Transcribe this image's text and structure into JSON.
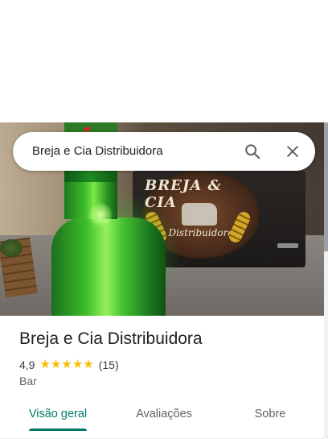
{
  "search": {
    "query": "Breja e Cia Distribuidora",
    "search_icon": "search-icon",
    "close_icon": "close-icon"
  },
  "hero": {
    "sign_line1": "BREJA & CIA",
    "sign_line2": "Distribuidora"
  },
  "place": {
    "name": "Breja e Cia Distribuidora",
    "rating": "4,9",
    "stars": 5,
    "review_count": "(15)",
    "category": "Bar"
  },
  "tabs": [
    {
      "label": "Visão geral",
      "active": true
    },
    {
      "label": "Avaliações",
      "active": false
    },
    {
      "label": "Sobre",
      "active": false
    }
  ],
  "colors": {
    "accent": "#00796b",
    "star": "#fbbc04"
  }
}
